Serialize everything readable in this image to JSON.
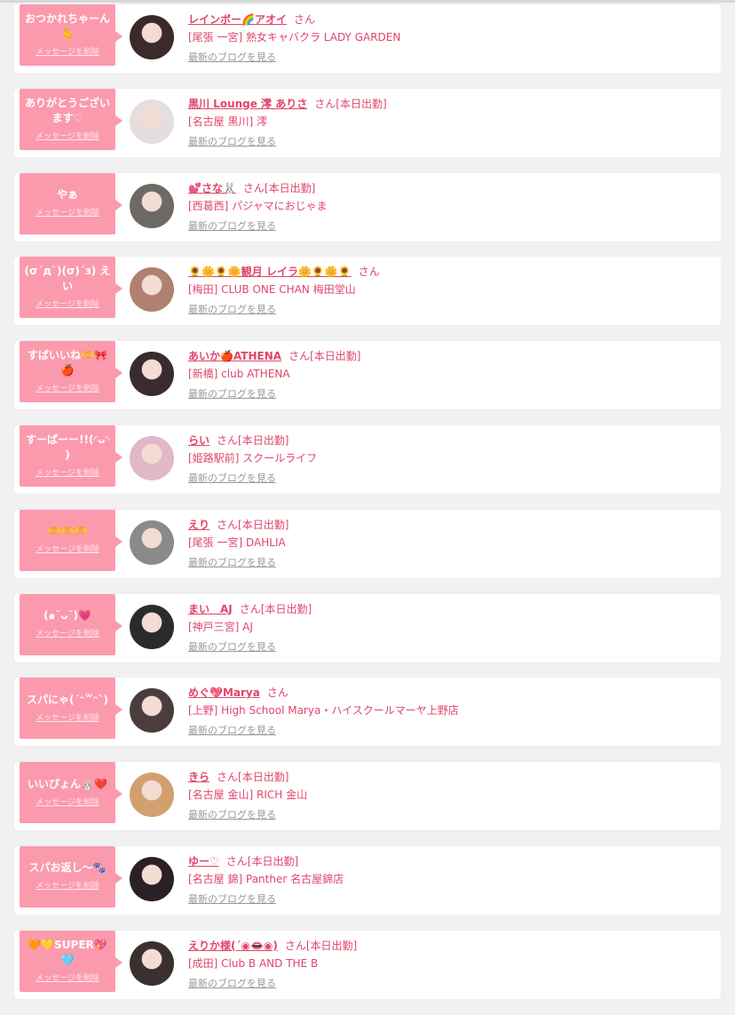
{
  "colors": {
    "bubble": "#fb9aad",
    "accent": "#e0456a",
    "blog_link": "#999999",
    "background": "#f1f1f1"
  },
  "labels": {
    "delete_message": "メッセージを削除",
    "view_blog": "最新のブログを見る",
    "honorific": "さん"
  },
  "messages": [
    {
      "message": "おつかれちゃーん🫰",
      "name": "レインボー🌈アオイ",
      "status": "",
      "shop": "[尾張 一宮] 熟女キャバクラ LADY GARDEN",
      "avatar_color": "#3a2a2a"
    },
    {
      "message": "ありがとうございます♡",
      "name": "黒川 Lounge 澪 ありさ",
      "status": "[本日出勤]",
      "shop": "[名古屋 黒川] 澪",
      "avatar_color": "#e6dede"
    },
    {
      "message": "やぁ",
      "name": "💕さな🐰",
      "status": "[本日出勤]",
      "shop": "[西葛西] パジャマにおじゃま",
      "avatar_color": "#6d6a66"
    },
    {
      "message": "(σ´д`)(σ)´з) えい",
      "name": "🌻🌼🌻🌼観月 レイラ🌼🌻🌼🌻",
      "status": "",
      "shop": "[梅田] CLUB ONE CHAN 梅田堂山",
      "avatar_color": "#b08070"
    },
    {
      "message": "すばいいね🫶🎀🍎",
      "name": "あいか🍎ATHENA",
      "status": "[本日出勤]",
      "shop": "[新橋] club ATHENA",
      "avatar_color": "#3a2c2e"
    },
    {
      "message": "すーぱーー!!(◜ᴗ◝ )",
      "name": "らい",
      "status": "[本日出勤]",
      "shop": "[姫路駅前] スクールライフ",
      "avatar_color": "#e0b8c8"
    },
    {
      "message": "🫶🫶🫶",
      "name": "えり",
      "status": "[本日出勤]",
      "shop": "[尾張 一宮] DAHLIA",
      "avatar_color": "#8a8a8a"
    },
    {
      "message": "(๑˘ᴗ˘)💗",
      "name": "まい　AJ",
      "status": "[本日出勤]",
      "shop": "[神戸三宮] AJ",
      "avatar_color": "#2b2b2b"
    },
    {
      "message": "スパにゃ(ˊᵔ꒳ᵔˋ)",
      "name": "めぐ💖Marya",
      "status": "",
      "shop": "[上野] High School Marya・ハイスクールマーヤ上野店",
      "avatar_color": "#4a3d3d"
    },
    {
      "message": "いいぴょん🐰❤️",
      "name": "きら",
      "status": "[本日出勤]",
      "shop": "[名古屋 金山] RICH 金山",
      "avatar_color": "#d2a070"
    },
    {
      "message": "スパお返し〜🐾",
      "name": "ゆー♡",
      "status": "[本日出勤]",
      "shop": "[名古屋 錦] Panther 名古屋錦店",
      "avatar_color": "#2a2026"
    },
    {
      "message": "🧡💛SUPER💖🩵",
      "name": "えりか様(´◉👄◉)",
      "status": "[本日出勤]",
      "shop": "[成田] Club B AND THE B",
      "avatar_color": "#3b3030"
    }
  ]
}
